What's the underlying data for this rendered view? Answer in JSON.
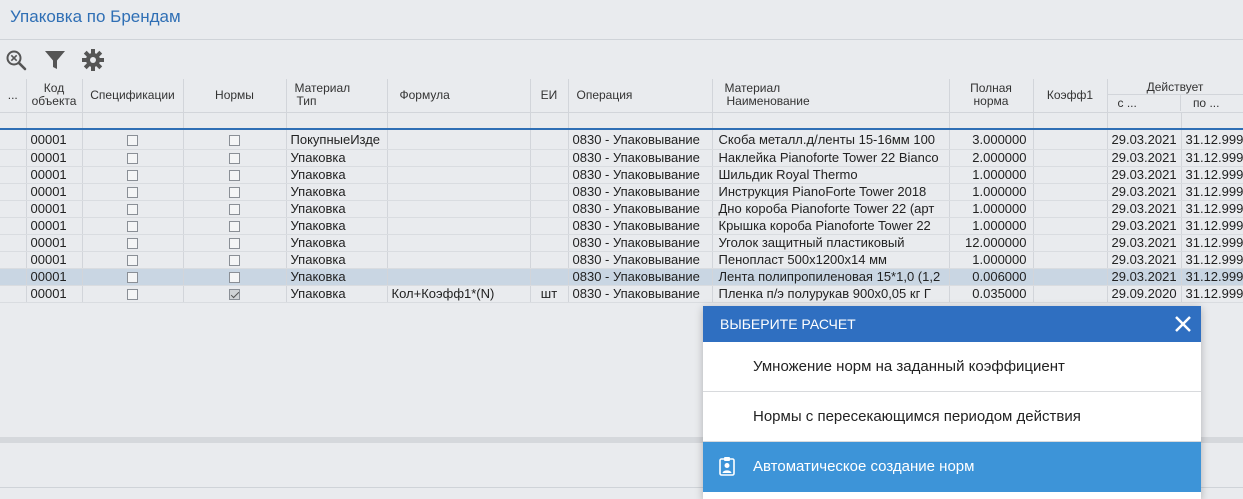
{
  "page": {
    "title": "Упаковка по Брендам"
  },
  "toolbar": {
    "icons": [
      "zoom-icon",
      "filter-icon",
      "gear-icon"
    ]
  },
  "table": {
    "headers": {
      "more": "...",
      "code_l1": "Код",
      "code_l2": "объекта",
      "spec": "Спецификации",
      "norms": "Нормы",
      "mat_l1": "Материал",
      "mat_l2": "Тип",
      "formula": "Формула",
      "ei": "ЕИ",
      "op": "Операция",
      "matname_l1": "Материал",
      "matname_l2": "Наименование",
      "full_l1": "Полная",
      "full_l2": "норма",
      "coef": "Коэфф1",
      "valid": "Действует",
      "from": "с ...",
      "to": "по ..."
    },
    "rows": [
      {
        "code": "00001",
        "spec": false,
        "norm": false,
        "type": "ПокупныеИзде",
        "formula": "",
        "ei": "",
        "op": "0830 - Упаковывание",
        "name": "Скоба металл.д/ленты 15-16мм 100",
        "full": "3.000000",
        "coef": "",
        "from": "29.03.2021",
        "to": "31.12.999"
      },
      {
        "code": "00001",
        "spec": false,
        "norm": false,
        "type": "Упаковка",
        "formula": "",
        "ei": "",
        "op": "0830 - Упаковывание",
        "name": "Наклейка Pianoforte Tower 22 Bianco",
        "full": "2.000000",
        "coef": "",
        "from": "29.03.2021",
        "to": "31.12.999"
      },
      {
        "code": "00001",
        "spec": false,
        "norm": false,
        "type": "Упаковка",
        "formula": "",
        "ei": "",
        "op": "0830 - Упаковывание",
        "name": "Шильдик Royal Thermo",
        "full": "1.000000",
        "coef": "",
        "from": "29.03.2021",
        "to": "31.12.999"
      },
      {
        "code": "00001",
        "spec": false,
        "norm": false,
        "type": "Упаковка",
        "formula": "",
        "ei": "",
        "op": "0830 - Упаковывание",
        "name": "Инструкция PianoForte Tower 2018",
        "full": "1.000000",
        "coef": "",
        "from": "29.03.2021",
        "to": "31.12.999"
      },
      {
        "code": "00001",
        "spec": false,
        "norm": false,
        "type": "Упаковка",
        "formula": "",
        "ei": "",
        "op": "0830 - Упаковывание",
        "name": "Дно короба Pianoforte Tower 22 (арт",
        "full": "1.000000",
        "coef": "",
        "from": "29.03.2021",
        "to": "31.12.999"
      },
      {
        "code": "00001",
        "spec": false,
        "norm": false,
        "type": "Упаковка",
        "formula": "",
        "ei": "",
        "op": "0830 - Упаковывание",
        "name": "Крышка короба Pianoforte Tower 22",
        "full": "1.000000",
        "coef": "",
        "from": "29.03.2021",
        "to": "31.12.999"
      },
      {
        "code": "00001",
        "spec": false,
        "norm": false,
        "type": "Упаковка",
        "formula": "",
        "ei": "",
        "op": "0830 - Упаковывание",
        "name": "Уголок защитный пластиковый",
        "full": "12.000000",
        "coef": "",
        "from": "29.03.2021",
        "to": "31.12.999"
      },
      {
        "code": "00001",
        "spec": false,
        "norm": false,
        "type": "Упаковка",
        "formula": "",
        "ei": "",
        "op": "0830 - Упаковывание",
        "name": "Пенопласт 500x1200x14 мм",
        "full": "1.000000",
        "coef": "",
        "from": "29.03.2021",
        "to": "31.12.999"
      },
      {
        "code": "00001",
        "spec": false,
        "norm": false,
        "type": "Упаковка",
        "formula": "",
        "ei": "",
        "op": "0830 - Упаковывание",
        "name": "Лента полипропиленовая 15*1,0 (1,2",
        "full": "0.006000",
        "coef": "",
        "from": "29.03.2021",
        "to": "31.12.999"
      },
      {
        "code": "00001",
        "spec": false,
        "norm": true,
        "type": "Упаковка",
        "formula": "Кол+Коэфф1*(N)",
        "ei": "шт",
        "op": "0830 - Упаковывание",
        "name": "Пленка п/э полурукав 900x0,05 кг Г",
        "full": "0.035000",
        "coef": "",
        "from": "29.09.2020",
        "to": "31.12.999"
      }
    ],
    "selected_row": 8
  },
  "dialog": {
    "title": "ВЫБЕРИТЕ РАСЧЕТ",
    "options": [
      {
        "label": "Умножение норм на заданный коэффициент",
        "active": false
      },
      {
        "label": "Нормы с пересекающимся периодом действия",
        "active": false
      },
      {
        "label": "Автоматическое создание норм",
        "active": true,
        "icon": "clipboard-user-icon"
      }
    ]
  },
  "colors": {
    "accent": "#2f6fb5",
    "dialog_header": "#2f6fc1",
    "active_option": "#3d94d8",
    "selected_row": "#c9d6e3"
  }
}
